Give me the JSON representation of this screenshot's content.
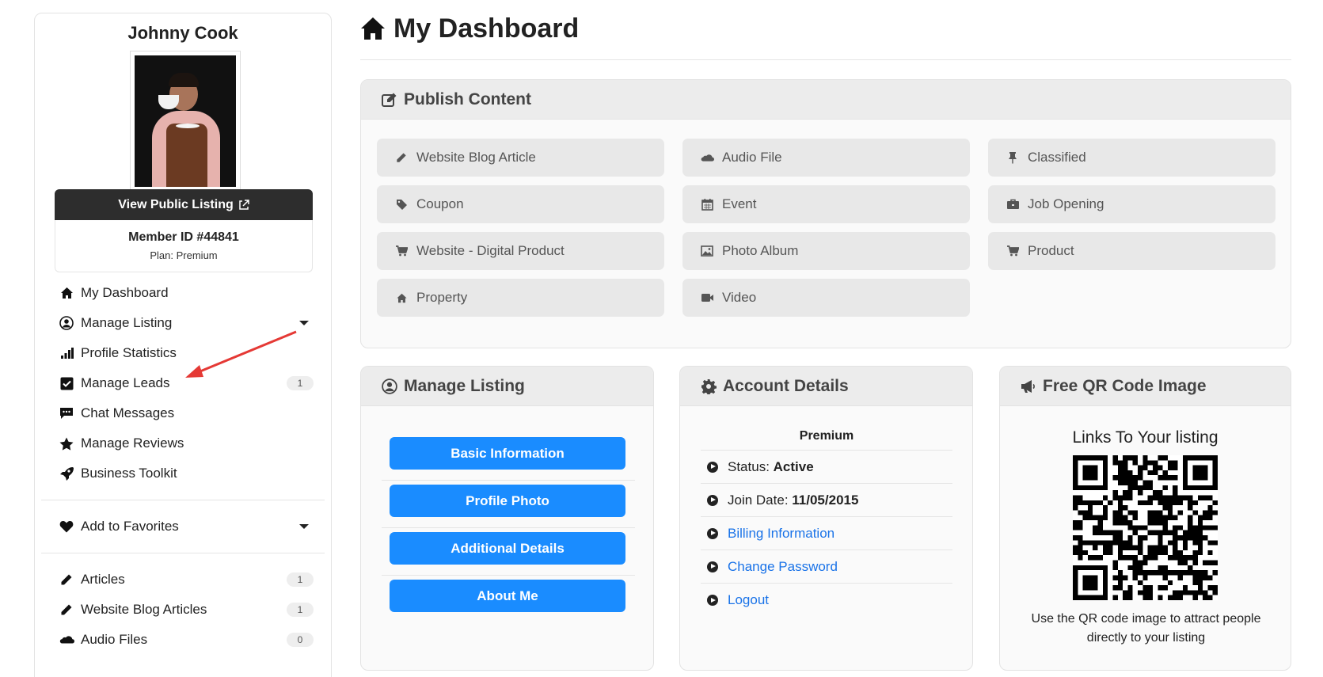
{
  "profile": {
    "name": "Johnny Cook",
    "view_listing_label": "View Public Listing",
    "member_id": "Member ID #44841",
    "plan": "Plan: Premium"
  },
  "nav": {
    "items": [
      {
        "label": "My Dashboard",
        "icon": "home-icon"
      },
      {
        "label": "Manage Listing",
        "icon": "user-circle-icon",
        "caret": true
      },
      {
        "label": "Profile Statistics",
        "icon": "bar-chart-icon"
      },
      {
        "label": "Manage Leads",
        "icon": "check-square-icon",
        "badge": "1"
      },
      {
        "label": "Chat Messages",
        "icon": "chat-icon"
      },
      {
        "label": "Manage Reviews",
        "icon": "star-icon"
      },
      {
        "label": "Business Toolkit",
        "icon": "rocket-icon"
      }
    ],
    "favorites": {
      "label": "Add to Favorites",
      "icon": "heart-icon"
    },
    "content": [
      {
        "label": "Articles",
        "icon": "pencil-icon",
        "badge": "1"
      },
      {
        "label": "Website Blog Articles",
        "icon": "pencil-icon",
        "badge": "1"
      },
      {
        "label": "Audio Files",
        "icon": "cloud-icon",
        "badge": "0"
      }
    ]
  },
  "page": {
    "title": "My Dashboard"
  },
  "publish": {
    "title": "Publish Content",
    "items": [
      {
        "label": "Website Blog Article",
        "icon": "pencil-icon"
      },
      {
        "label": "Audio File",
        "icon": "cloud-icon"
      },
      {
        "label": "Classified",
        "icon": "pushpin-icon"
      },
      {
        "label": "Coupon",
        "icon": "tag-icon"
      },
      {
        "label": "Event",
        "icon": "calendar-icon"
      },
      {
        "label": "Job Opening",
        "icon": "briefcase-icon"
      },
      {
        "label": "Website - Digital Product",
        "icon": "cart-icon"
      },
      {
        "label": "Photo Album",
        "icon": "picture-icon"
      },
      {
        "label": "Product",
        "icon": "cart-icon"
      },
      {
        "label": "Property",
        "icon": "home-icon"
      },
      {
        "label": "Video",
        "icon": "video-camera-icon"
      }
    ]
  },
  "manage_listing": {
    "title": "Manage Listing",
    "buttons": [
      "Basic Information",
      "Profile Photo",
      "Additional Details",
      "About Me"
    ]
  },
  "account": {
    "title": "Account Details",
    "plan": "Premium",
    "status_label": "Status:",
    "status_value": "Active",
    "join_label": "Join Date:",
    "join_value": "11/05/2015",
    "links": [
      "Billing Information",
      "Change Password",
      "Logout"
    ]
  },
  "qr": {
    "title": "Free QR Code Image",
    "heading": "Links To Your listing",
    "caption": "Use the QR code image to attract people directly to your listing"
  },
  "colors": {
    "accent_blue": "#1a8cff",
    "link_blue": "#1a73e8",
    "annotation_red": "#e53935"
  }
}
